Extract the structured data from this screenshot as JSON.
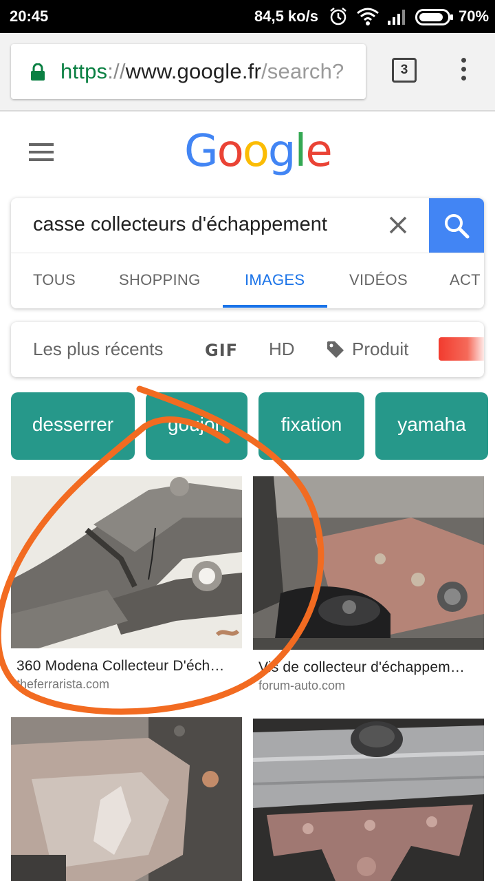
{
  "status_bar": {
    "time": "20:45",
    "speed": "84,5 ko/s",
    "battery": "70%",
    "icons": [
      "alarm-icon",
      "wifi-icon",
      "signal-icon",
      "battery-icon"
    ]
  },
  "browser": {
    "url_scheme": "https",
    "url_slashes": "://",
    "url_host": "www.google.fr",
    "url_path": "/search?",
    "tab_count": "3",
    "secure_color": "#0b8043"
  },
  "header": {
    "logo_letters": [
      "G",
      "o",
      "o",
      "g",
      "l",
      "e"
    ],
    "logo_colors": [
      "#4285f4",
      "#ea4335",
      "#fbbc05",
      "#4285f4",
      "#34a853",
      "#ea4335"
    ]
  },
  "search": {
    "query": "casse collecteurs d'échappement",
    "accent": "#4285f4"
  },
  "tabs": [
    "TOUS",
    "SHOPPING",
    "IMAGES",
    "VIDÉOS",
    "ACT"
  ],
  "active_tab": "IMAGES",
  "filters": {
    "recent": "Les plus récents",
    "gif": "GIF",
    "hd": "HD",
    "product": "Produit",
    "color_swatch": "#f23b2e"
  },
  "chips": [
    "desserrer",
    "goujon",
    "fixation",
    "yamaha"
  ],
  "chip_color": "#26988a",
  "results": [
    {
      "title": "360 Modena Collecteur D'éch…",
      "source": "theferrarista.com"
    },
    {
      "title": "Vis de collecteur d'échappem…",
      "source": "forum-auto.com"
    },
    {
      "title": "",
      "source": ""
    },
    {
      "title": "",
      "source": ""
    }
  ],
  "annotation_color": "#f26b21"
}
